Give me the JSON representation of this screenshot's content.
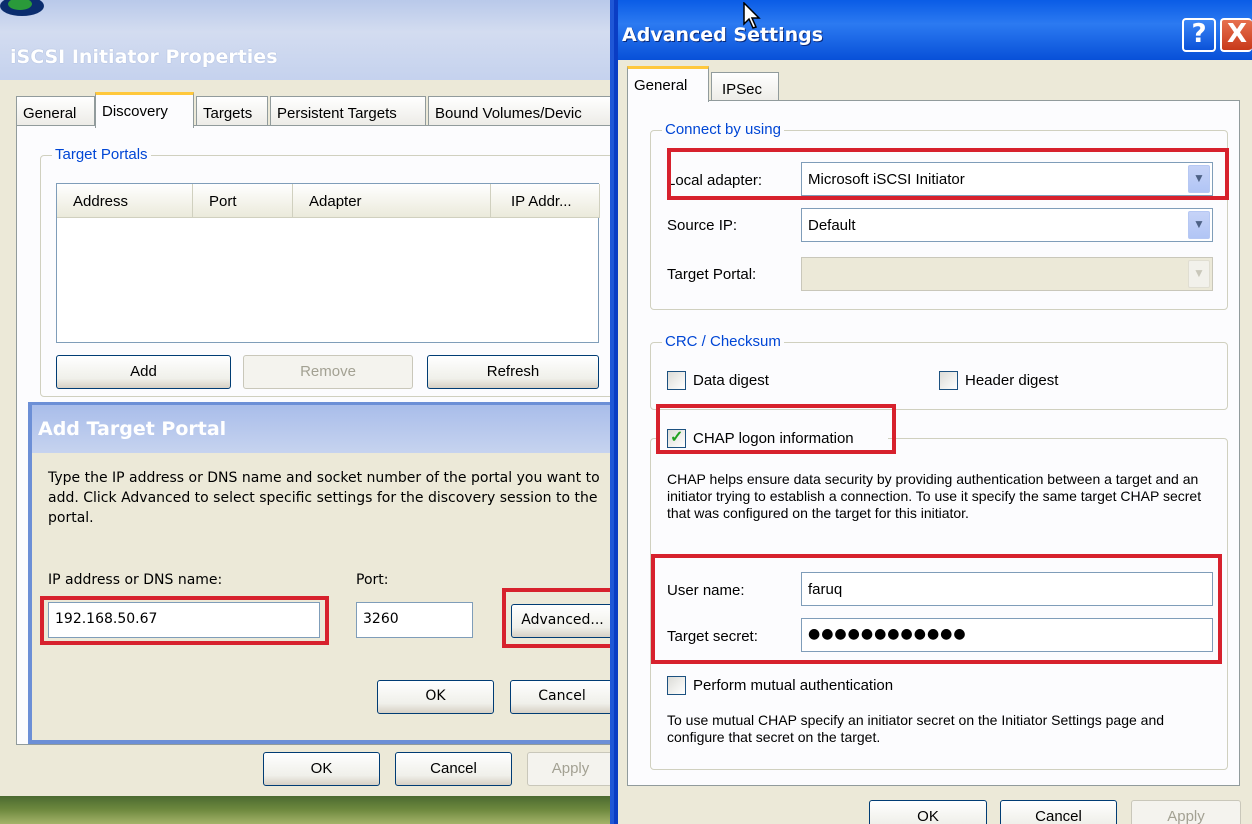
{
  "left_window": {
    "title": "iSCSI Initiator Properties",
    "tabs": [
      "General",
      "Discovery",
      "Targets",
      "Persistent Targets",
      "Bound Volumes/Devic"
    ],
    "active_tab": "Discovery",
    "target_portals": {
      "group_label": "Target Portals",
      "columns": [
        "Address",
        "Port",
        "Adapter",
        "IP Addr..."
      ],
      "rows": [],
      "add_label": "Add",
      "remove_label": "Remove",
      "refresh_label": "Refresh"
    },
    "footer": {
      "ok_label": "OK",
      "cancel_label": "Cancel",
      "apply_label": "Apply"
    }
  },
  "add_target_portal": {
    "title": "Add Target Portal",
    "description": "Type the IP address or DNS name and socket number of the portal you want to add. Click Advanced to select specific settings for the discovery session to the portal.",
    "ip_label": "IP address or DNS name:",
    "ip_value": "192.168.50.67",
    "port_label": "Port:",
    "port_value": "3260",
    "advanced_label": "Advanced...",
    "ok_label": "OK",
    "cancel_label": "Cancel"
  },
  "advanced_settings": {
    "title": "Advanced Settings",
    "help_button": "?",
    "close_button": "X",
    "tabs": [
      "General",
      "IPSec"
    ],
    "active_tab": "General",
    "connect": {
      "group_label": "Connect by using",
      "local_adapter_label": "Local adapter:",
      "local_adapter_value": "Microsoft iSCSI Initiator",
      "source_ip_label": "Source IP:",
      "source_ip_value": "Default",
      "target_portal_label": "Target Portal:",
      "target_portal_value": ""
    },
    "crc": {
      "group_label": "CRC / Checksum",
      "data_digest_label": "Data digest",
      "data_digest_checked": false,
      "header_digest_label": "Header digest",
      "header_digest_checked": false
    },
    "chap": {
      "enable_label": "CHAP logon information",
      "enable_checked": true,
      "description": "CHAP helps ensure data security by providing authentication between a target and an initiator trying to establish a connection. To use it specify the same target CHAP secret that was configured on the target for this initiator.",
      "user_name_label": "User name:",
      "user_name_value": "faruq",
      "target_secret_label": "Target secret:",
      "target_secret_value": "●●●●●●●●●●●●",
      "mutual_label": "Perform mutual authentication",
      "mutual_checked": false,
      "mutual_description": "To use mutual CHAP specify an initiator secret on the Initiator Settings page and configure that secret on the target."
    },
    "footer": {
      "ok_label": "OK",
      "cancel_label": "Cancel",
      "apply_label": "Apply"
    }
  },
  "colors": {
    "highlight_box": "#d7212d",
    "group_label": "#0046d5",
    "xp_blue": "#0a5ce6"
  }
}
